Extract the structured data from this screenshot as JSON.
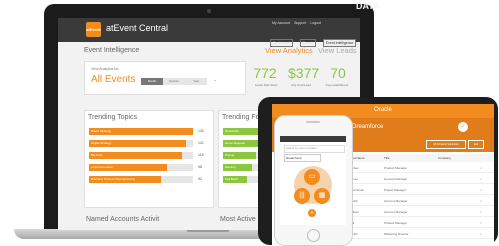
{
  "watermark": "DATA",
  "app": {
    "logo_text": "atEvent",
    "title": "atEvent Central",
    "top_links": [
      "My Account",
      "Support",
      "Logout"
    ],
    "top_buttons": [
      "Dashboard",
      "Events",
      "Event Intelligence"
    ]
  },
  "event_intel": {
    "title": "Event Intelligence",
    "view_analytics": "View Analytics",
    "view_leads": "View Leads",
    "select_label": "View Analytics for:",
    "select_value": "All Events",
    "range_buttons": [
      "Month",
      "Quarter",
      "Year"
    ],
    "stats": [
      {
        "value": "772",
        "label": "Leads Submitted"
      },
      {
        "value": "$377",
        "label": "Avg Cost/Lead"
      },
      {
        "value": "70",
        "label": "Avg Leads/Event"
      }
    ]
  },
  "trending_topics": {
    "title": "Trending Topics",
    "items": [
      {
        "label": "Brand Strategy",
        "count": "130",
        "fraction": 1.0
      },
      {
        "label": "Digital Strategy",
        "count": "121",
        "fraction": 0.93
      },
      {
        "label": "Big Data",
        "count": "116",
        "fraction": 0.89
      },
      {
        "label": "Lead Generation",
        "count": "98",
        "fraction": 0.75
      },
      {
        "label": "Business Process Reengineering",
        "count": "92",
        "fraction": 0.69
      }
    ]
  },
  "trending_follow": {
    "title": "Trending Follow Up",
    "items": [
      {
        "label": "Newsletter",
        "fraction": 0.72
      },
      {
        "label": "Demo Request",
        "fraction": 0.6
      },
      {
        "label": "Pricing",
        "fraction": 0.55
      },
      {
        "label": "Meeting",
        "fraction": 0.48
      },
      {
        "label": "Call Back",
        "fraction": 0.4
      }
    ]
  },
  "bottom_sections": [
    "Named Accounts Activit",
    "Most Active Users"
  ],
  "tablet": {
    "header_title": "Oracle",
    "sub_title": "Dreamforce",
    "buttons": [
      "All Contacts Submitted",
      "Edit"
    ],
    "columns": [
      "First Name",
      "Last Name",
      "Title",
      "Company"
    ],
    "rows": [
      [
        "Hellen",
        "Cohen",
        "Product Manager"
      ],
      [
        "Abe",
        "Jones",
        "General Manager"
      ],
      [
        "Angela",
        "Thompson",
        "Project Manager"
      ],
      [
        "Jamarie",
        "Smith",
        "Account Manager"
      ],
      [
        "Bryan",
        "Wilson",
        "Account Manager"
      ],
      [
        "Josie",
        "Hill",
        "Product Manager"
      ],
      [
        "Wendy",
        "Smith",
        "Marketing Director"
      ]
    ]
  },
  "phone": {
    "search_placeholder": "Search by event or location",
    "select_value": "Dreamforce"
  }
}
